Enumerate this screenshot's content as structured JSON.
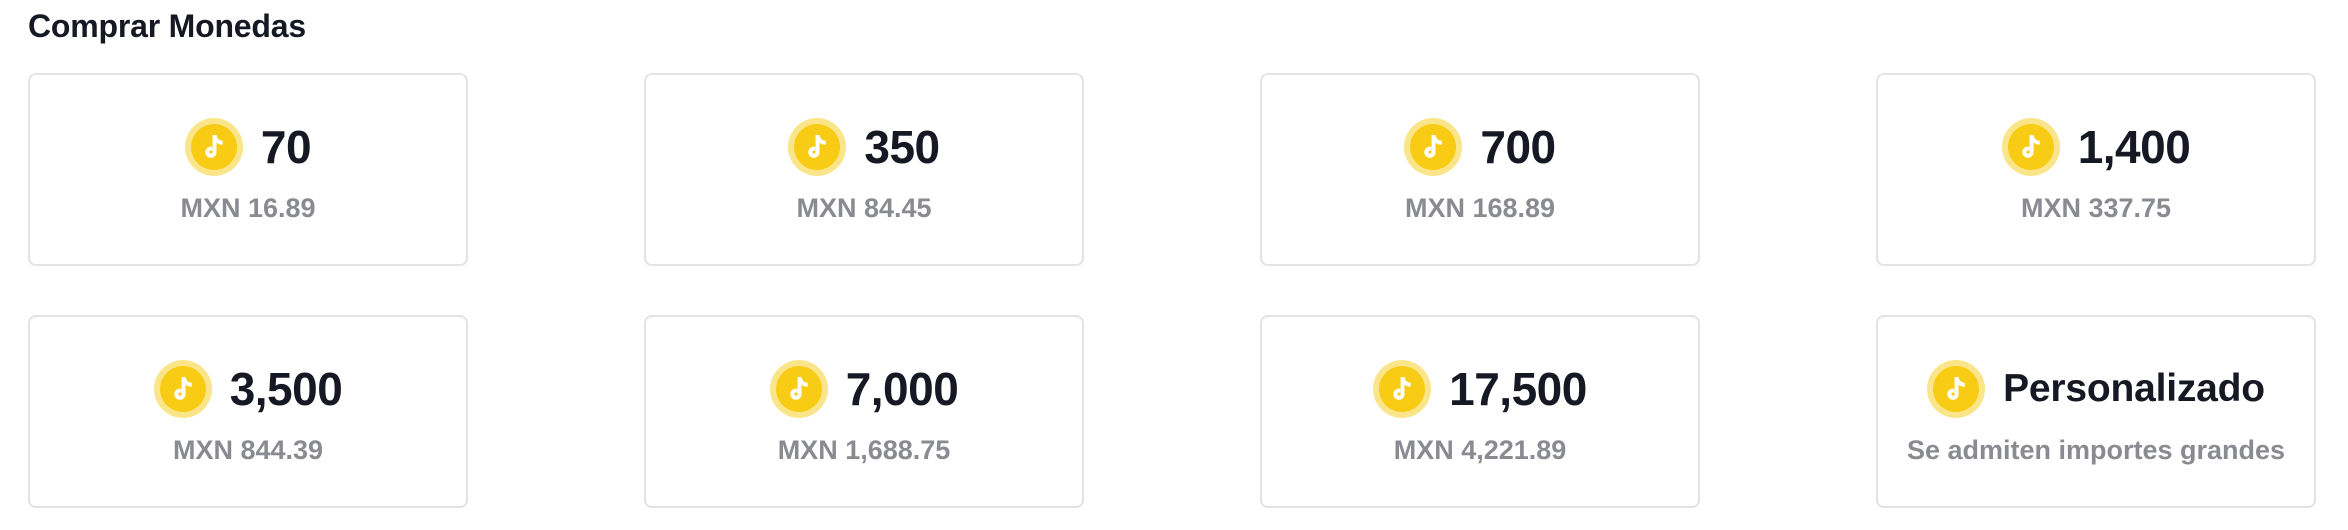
{
  "page": {
    "title": "Comprar Monedas"
  },
  "coin_icon": "tiktok-coin-icon",
  "colors": {
    "coin_outer": "#fbe58a",
    "coin_inner": "#f8cc15",
    "text_primary": "#161823",
    "text_secondary": "#8a8b91",
    "card_border": "#e3e3e4"
  },
  "packages": [
    {
      "amount": "70",
      "price": "MXN 16.89"
    },
    {
      "amount": "350",
      "price": "MXN 84.45"
    },
    {
      "amount": "700",
      "price": "MXN 168.89"
    },
    {
      "amount": "1,400",
      "price": "MXN 337.75"
    },
    {
      "amount": "3,500",
      "price": "MXN 844.39"
    },
    {
      "amount": "7,000",
      "price": "MXN 1,688.75"
    },
    {
      "amount": "17,500",
      "price": "MXN 4,221.89"
    },
    {
      "amount": "Personalizado",
      "price": "Se admiten importes grandes"
    }
  ]
}
